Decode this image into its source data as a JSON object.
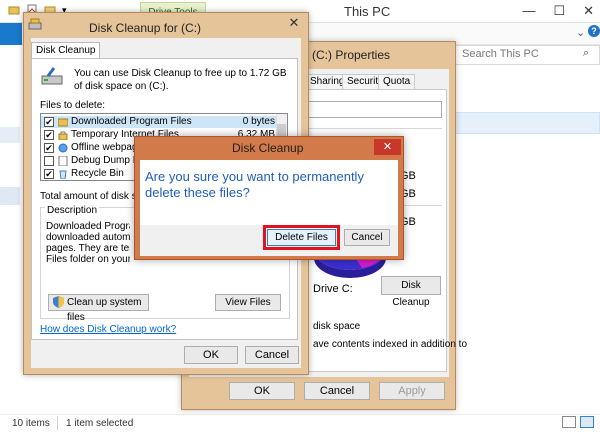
{
  "explorer": {
    "title": "This PC",
    "context_tab": "Drive Tools",
    "search_placeholder": "Search This PC",
    "status_items": "10 items",
    "status_selected": "1 item selected",
    "controls": {
      "minimize": "—",
      "maximize": "☐",
      "close": "✕"
    }
  },
  "properties": {
    "title": "(C:) Properties",
    "tabs": [
      "Sharing",
      "Security",
      "Quota"
    ],
    "used_gb": "GB",
    "free_gb": "GB",
    "capacity_gb": "GB",
    "drive_label": "Drive C:",
    "disk_cleanup_button": "Disk Cleanup",
    "compress_text": "disk space",
    "index_text": "ave contents indexed in addition to",
    "ok": "OK",
    "cancel": "Cancel",
    "apply": "Apply"
  },
  "disk_cleanup": {
    "title": "Disk Cleanup for  (C:)",
    "tab": "Disk Cleanup",
    "intro": "You can use Disk Cleanup to free up to 1.72 GB of disk space on  (C:).",
    "files_to_delete_label": "Files to delete:",
    "files": [
      {
        "name": "Downloaded Program Files",
        "size": "0 bytes",
        "checked": true
      },
      {
        "name": "Temporary Internet Files",
        "size": "6.32 MB",
        "checked": true
      },
      {
        "name": "Offline webpages",
        "size": "",
        "checked": true
      },
      {
        "name": "Debug Dump Files",
        "size": "",
        "checked": false
      },
      {
        "name": "Recycle Bin",
        "size": "",
        "checked": true
      }
    ],
    "total_label": "Total amount of disk space",
    "description_label": "Description",
    "description_lines": [
      "Downloaded Program F",
      "downloaded automatic",
      "pages. They are tempo",
      "Files folder on your hard"
    ],
    "cleanup_system_button": "Clean up system files",
    "view_files_button": "View Files",
    "how_link": "How does Disk Cleanup work?",
    "ok": "OK",
    "cancel": "Cancel"
  },
  "confirm": {
    "title": "Disk Cleanup",
    "message": "Are you sure you want to permanently delete these files?",
    "delete_button": "Delete Files",
    "cancel_button": "Cancel",
    "close": "✕"
  },
  "colors": {
    "window_frame": "#e6c49a",
    "confirm_frame": "#d27a4a",
    "highlight": "#e0121e",
    "message_text": "#1f5fb8",
    "link": "#0066cc"
  }
}
